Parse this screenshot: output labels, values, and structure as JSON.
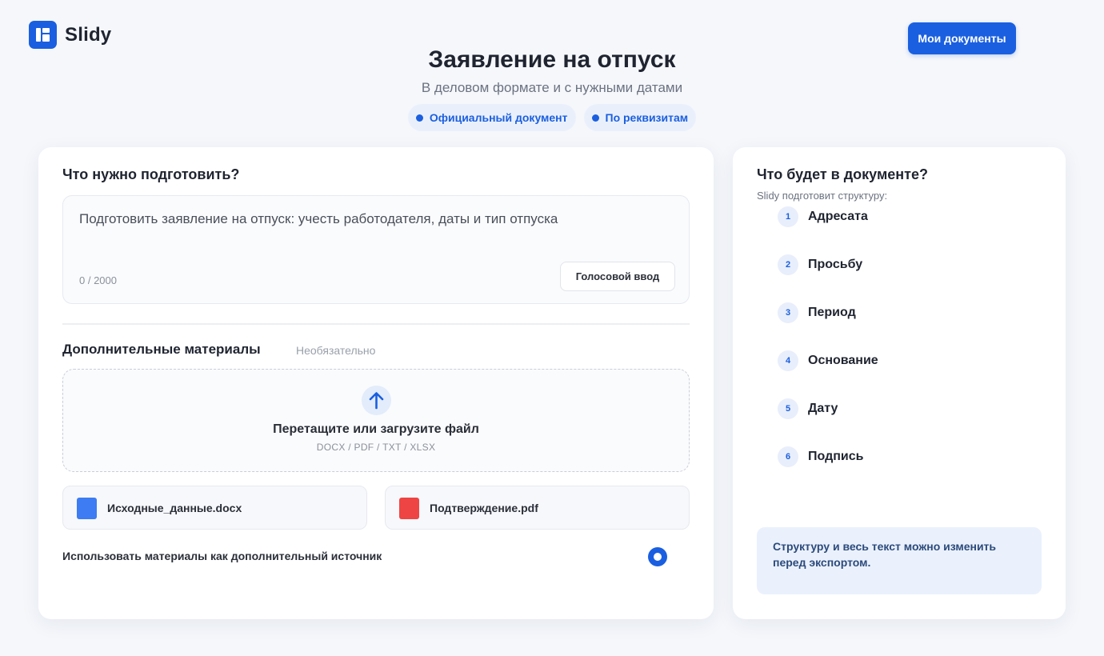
{
  "app": {
    "name": "Slidy"
  },
  "header": {
    "my_docs_label": "Мои документы"
  },
  "hero": {
    "title": "Заявление на отпуск",
    "subtitle": "В деловом формате и с нужными датами",
    "chips": [
      {
        "label": "Официальный документ"
      },
      {
        "label": "По реквизитам"
      }
    ]
  },
  "left": {
    "title": "Что нужно подготовить?",
    "prompt_text": "Подготовить заявление на отпуск: учесть работодателя, даты и тип отпуска",
    "counter": "0 / 2000",
    "voice_label": "Голосовой ввод",
    "extra": {
      "title": "Дополнительные материалы",
      "optional": "Необязательно",
      "drop_title": "Перетащите или загрузите файл",
      "drop_formats": "DOCX / PDF / TXT / XLSX"
    },
    "files": [
      {
        "name": "Исходные_данные.docx",
        "color": "#3d7cf2"
      },
      {
        "name": "Подтверждение.pdf",
        "color": "#ef4444"
      }
    ],
    "use_as_source_label": "Использовать материалы как дополнительный источник",
    "use_as_source": true
  },
  "right": {
    "title": "Что будет в документе?",
    "subtitle": "Slidy подготовит структуру:",
    "steps": [
      {
        "num": "1",
        "label": "Адресата"
      },
      {
        "num": "2",
        "label": "Просьбу"
      },
      {
        "num": "3",
        "label": "Период"
      },
      {
        "num": "4",
        "label": "Основание"
      },
      {
        "num": "5",
        "label": "Дату"
      },
      {
        "num": "6",
        "label": "Подпись"
      }
    ],
    "note": "Структуру и весь текст можно изменить перед экспортом."
  },
  "colors": {
    "accent": "#1a5fe0",
    "background": "#f5f7fb"
  }
}
